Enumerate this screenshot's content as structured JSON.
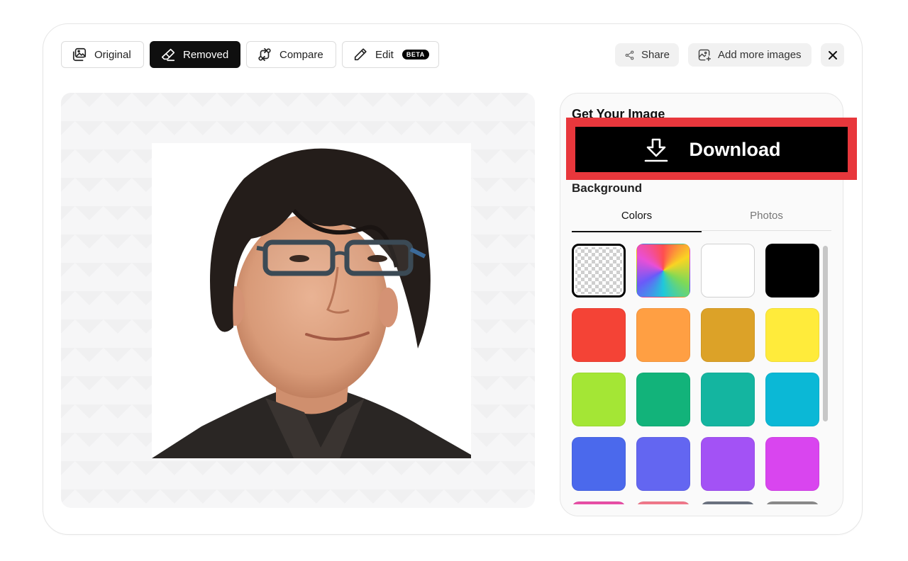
{
  "toolbar": {
    "tabs": [
      {
        "label": "Original",
        "icon": "image-icon"
      },
      {
        "label": "Removed",
        "icon": "eraser-icon",
        "active": true
      },
      {
        "label": "Compare",
        "icon": "compare-icon"
      },
      {
        "label": "Edit",
        "icon": "pencil-icon",
        "badge": "BETA"
      }
    ],
    "share_label": "Share",
    "add_images_label": "Add more images",
    "close_icon": "close-icon"
  },
  "panel": {
    "title": "Get Your Image",
    "download_label": "Download",
    "background_label": "Background",
    "subtabs": [
      "Colors",
      "Photos"
    ],
    "active_subtab": "Colors",
    "swatches": [
      {
        "name": "transparent",
        "color": "transparent",
        "selected": true
      },
      {
        "name": "gradient",
        "color": "conic-gradient"
      },
      {
        "name": "white",
        "color": "#ffffff"
      },
      {
        "name": "black",
        "color": "#000000"
      },
      {
        "name": "red",
        "color": "#f44336"
      },
      {
        "name": "orange",
        "color": "#ff9f43"
      },
      {
        "name": "mustard",
        "color": "#dca228"
      },
      {
        "name": "yellow",
        "color": "#ffeb3b"
      },
      {
        "name": "lime",
        "color": "#a4e635"
      },
      {
        "name": "green",
        "color": "#12b37a"
      },
      {
        "name": "teal",
        "color": "#14b5a0"
      },
      {
        "name": "cyan",
        "color": "#0bb8d6"
      },
      {
        "name": "blue",
        "color": "#4b69ec"
      },
      {
        "name": "indigo",
        "color": "#6366f1"
      },
      {
        "name": "purple",
        "color": "#a352f5"
      },
      {
        "name": "magenta",
        "color": "#d945ef"
      },
      {
        "name": "pink",
        "color": "#e84ea6"
      },
      {
        "name": "rose",
        "color": "#f0788a"
      },
      {
        "name": "slate",
        "color": "#6b7280"
      },
      {
        "name": "gray",
        "color": "#8a8a8a"
      }
    ]
  },
  "colors": {
    "highlight": "#e8373c",
    "active_tab": "#0f0f0f"
  }
}
